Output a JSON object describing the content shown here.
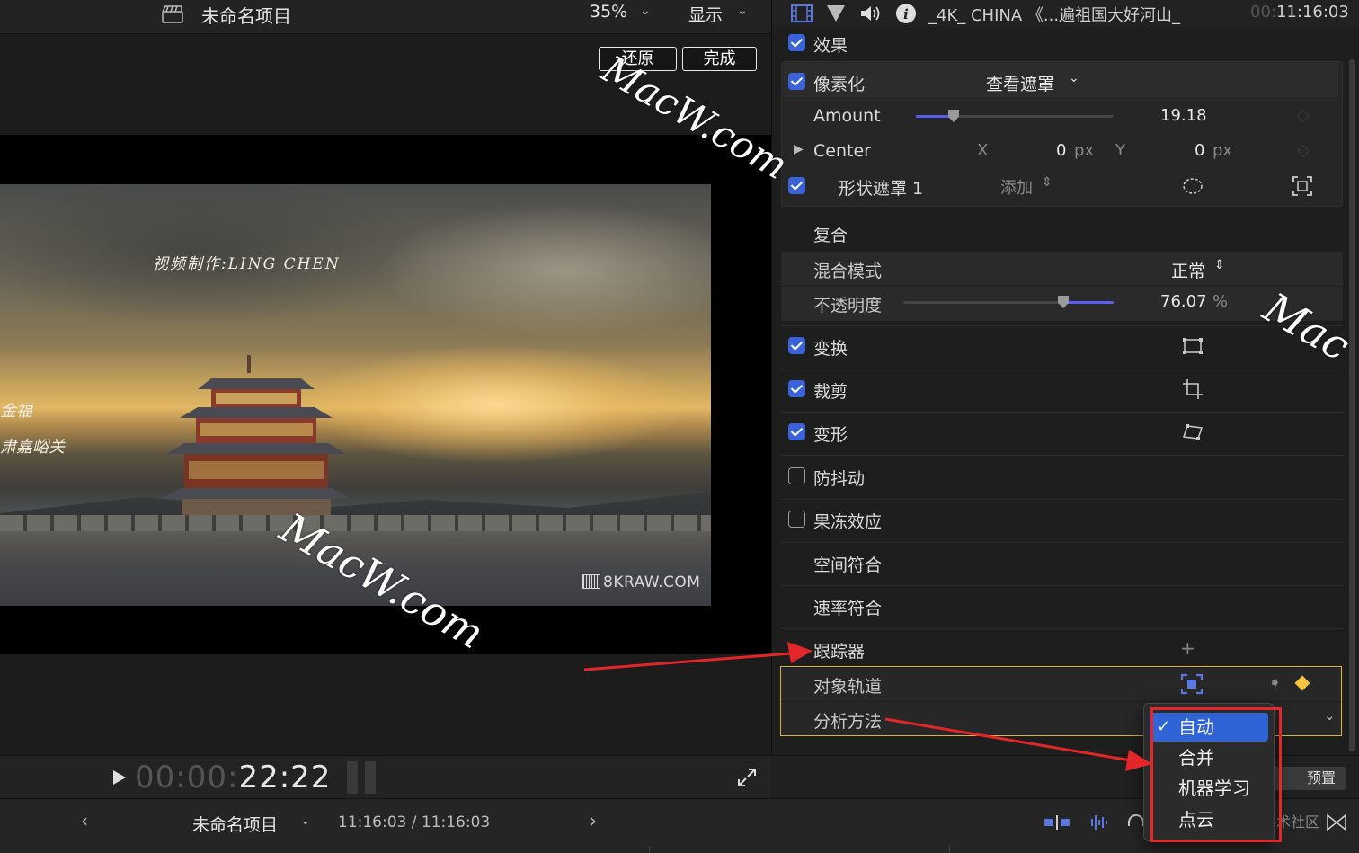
{
  "viewer": {
    "project_title": "未命名项目",
    "zoom": "35%",
    "view_menu": "显示",
    "reset_label": "还原",
    "done_label": "完成",
    "timecode_dim": "00:00:",
    "timecode": "22:22",
    "video_overlay": {
      "credit": "视频制作:LING CHEN",
      "left_line1": "金福",
      "left_line2": "肃嘉峪关",
      "brand": "8KRAW.COM"
    }
  },
  "inspector": {
    "header": {
      "clip_name": "_4K_ CHINA 《...遍祖国大好河山_",
      "clip_time_dim": "00:",
      "clip_time": "11:16:03"
    },
    "effects": {
      "heading": "效果",
      "pixelate": {
        "name": "像素化",
        "mask_menu": "查看遮罩",
        "amount_label": "Amount",
        "amount_value": "19.18",
        "amount_fraction": 0.19,
        "center_label": "Center",
        "x_label": "X",
        "x_value": "0",
        "x_unit": "px",
        "y_label": "Y",
        "y_value": "0",
        "y_unit": "px",
        "shape_mask_label": "形状遮罩 1",
        "add_label": "添加"
      }
    },
    "compositing": {
      "heading": "复合",
      "blend_label": "混合模式",
      "blend_value": "正常",
      "opacity_label": "不透明度",
      "opacity_value": "76.07",
      "opacity_unit": "%",
      "opacity_fraction": 0.7607
    },
    "sections": [
      {
        "label": "变换",
        "checked": true
      },
      {
        "label": "裁剪",
        "checked": true
      },
      {
        "label": "变形",
        "checked": true
      },
      {
        "label": "防抖动",
        "checked": false
      },
      {
        "label": "果冻效应",
        "checked": false
      },
      {
        "label": "空间符合"
      },
      {
        "label": "速率符合"
      }
    ],
    "tracker": {
      "heading": "跟踪器",
      "object_track_label": "对象轨道",
      "analysis_label": "分析方法"
    },
    "footer": {
      "save_preset_label": "预置"
    }
  },
  "analysis_menu": {
    "items": [
      "自动",
      "合并",
      "机器学习",
      "点云"
    ],
    "selected": "自动"
  },
  "bottom_bar": {
    "project": "未命名项目",
    "time": "11:16:03 / 11:16:03",
    "watermark": "稀土掘金技术社区"
  },
  "watermarks": {
    "macw1": "MacW.com",
    "macw2": "MacW.com",
    "macw3": "Mac"
  },
  "colors": {
    "accent": "#3b63d9",
    "highlight": "#d9b33a",
    "annotation": "#e3262a",
    "selection": "#2f64d6"
  }
}
